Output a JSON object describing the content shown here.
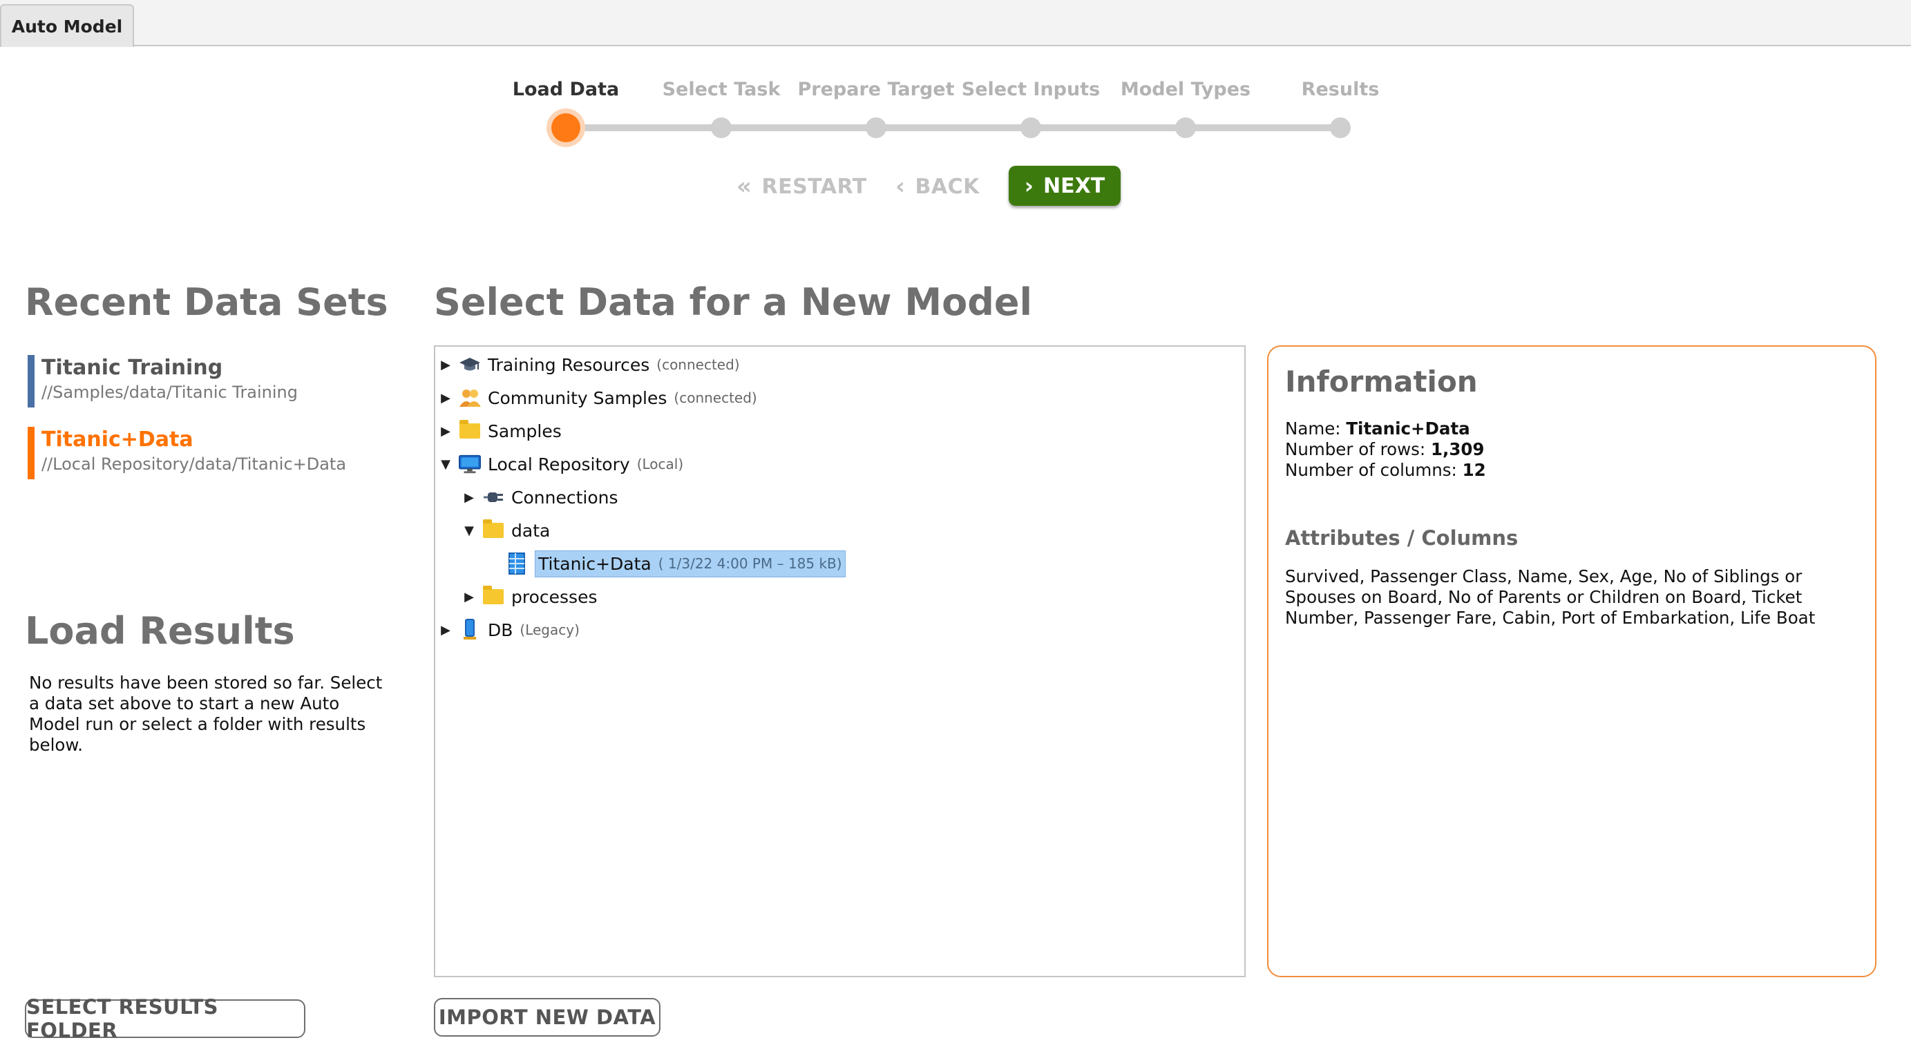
{
  "tab": {
    "label": "Auto Model"
  },
  "wizard": {
    "steps": [
      "Load Data",
      "Select Task",
      "Prepare Target",
      "Select Inputs",
      "Model Types",
      "Results"
    ],
    "active_step": "Load Data",
    "restart_label": "RESTART",
    "back_label": "BACK",
    "next_label": "NEXT"
  },
  "recent": {
    "heading": "Recent Data Sets",
    "items": [
      {
        "name": "Titanic Training",
        "path": "//Samples/data/Titanic Training",
        "color": "#4a6fa5"
      },
      {
        "name": "Titanic+Data",
        "path": "//Local Repository/data/Titanic+Data",
        "color": "#ff7200"
      }
    ]
  },
  "load_results": {
    "heading": "Load Results",
    "text": "No results have been stored so far. Select a data set above to start a new Auto Model run or select a folder with results below.",
    "button": "SELECT RESULTS FOLDER"
  },
  "select_data": {
    "heading": "Select Data for a New Model",
    "import_button": "IMPORT NEW DATA",
    "tree": [
      {
        "label": "Training Resources",
        "sub": "(connected)",
        "icon": "graduation-cap-icon",
        "expanded": false
      },
      {
        "label": "Community Samples",
        "sub": "(connected)",
        "icon": "community-icon",
        "expanded": false
      },
      {
        "label": "Samples",
        "sub": "",
        "icon": "folder-icon",
        "expanded": false
      },
      {
        "label": "Local Repository",
        "sub": "(Local)",
        "icon": "monitor-icon",
        "expanded": true
      },
      {
        "label": "Connections",
        "sub": "",
        "icon": "plug-icon",
        "expanded": false
      },
      {
        "label": "data",
        "sub": "",
        "icon": "folder-icon",
        "expanded": true
      },
      {
        "label": "Titanic+Data",
        "sub": "( 1/3/22 4:00 PM – 185 kB)",
        "icon": "dataset-icon",
        "selected": true
      },
      {
        "label": "processes",
        "sub": "",
        "icon": "folder-icon",
        "expanded": false
      },
      {
        "label": "DB",
        "sub": "(Legacy)",
        "icon": "database-icon",
        "expanded": false
      }
    ]
  },
  "info": {
    "title": "Information",
    "name_label": "Name: ",
    "name_value": "Titanic+Data",
    "rows_label": "Number of rows: ",
    "rows_value": "1,309",
    "cols_label": "Number of columns: ",
    "cols_value": "12",
    "attributes_title": "Attributes  /  Columns",
    "attributes": "Survived, Passenger Class, Name, Sex, Age, No of Siblings or Spouses on Board, No of Parents or Children on Board, Ticket Number, Passenger Fare, Cabin, Port of Embarkation, Life Boat"
  },
  "colors": {
    "accent": "#ff7a14",
    "next": "#3d7a0e",
    "panel_border": "#f28d3c"
  }
}
